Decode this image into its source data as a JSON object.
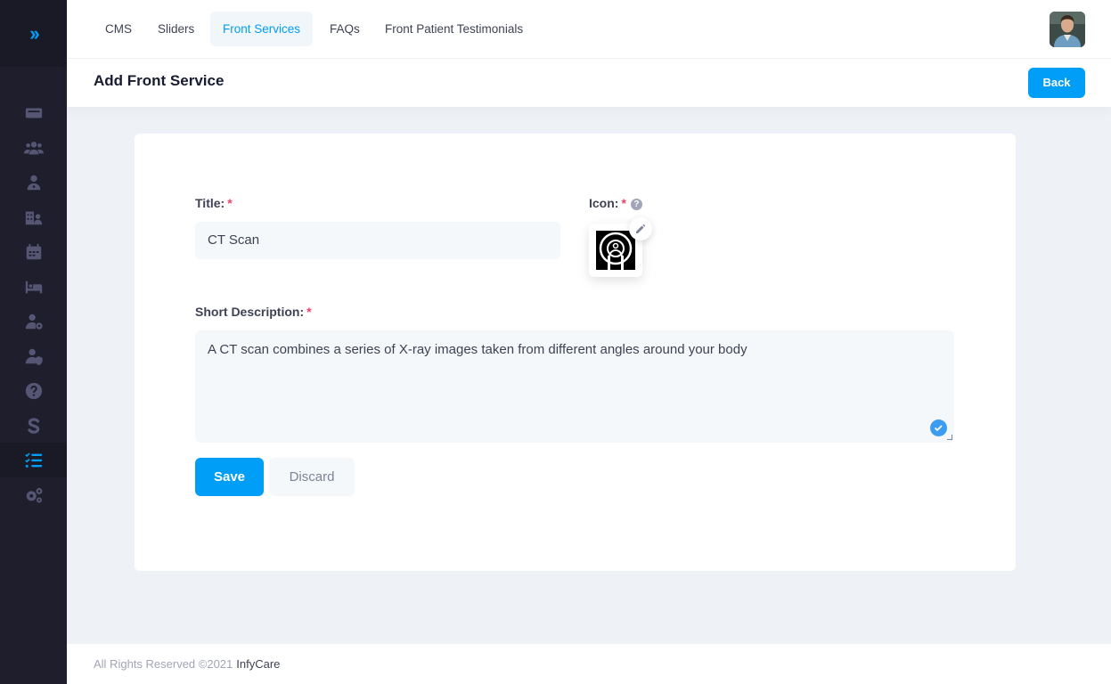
{
  "app": {
    "name": "InfyCare"
  },
  "colors": {
    "accent": "#009ef7",
    "sidebar": "#1e1e2d",
    "required": "#f1416c"
  },
  "sidebar": {
    "toggle_icon": "double-chevron-right-icon",
    "items": [
      {
        "icon": "dashboard-icon"
      },
      {
        "icon": "users-icon"
      },
      {
        "icon": "doctor-icon"
      },
      {
        "icon": "hospital-icon"
      },
      {
        "icon": "calendar-icon"
      },
      {
        "icon": "bed-icon"
      },
      {
        "icon": "user-settings-icon"
      },
      {
        "icon": "user-shield-icon"
      },
      {
        "icon": "question-icon"
      },
      {
        "icon": "subscription-s-icon"
      },
      {
        "icon": "cms-list-icon",
        "active": true
      },
      {
        "icon": "settings-gears-icon"
      }
    ]
  },
  "tabs": [
    {
      "label": "CMS"
    },
    {
      "label": "Sliders"
    },
    {
      "label": "Front Services",
      "active": true
    },
    {
      "label": "FAQs"
    },
    {
      "label": "Front Patient Testimonials"
    }
  ],
  "header": {
    "title": "Add Front Service",
    "back_label": "Back"
  },
  "form": {
    "title_label": "Title:",
    "title_value": "CT Scan",
    "icon_label": "Icon:",
    "required_mark": "*",
    "help_glyph": "?",
    "description_label": "Short Description:",
    "description_value": "A CT scan combines a series of X-ray images taken from different angles around your body",
    "save_label": "Save",
    "discard_label": "Discard"
  },
  "footer": {
    "text": "All Rights Reserved ©2021",
    "brand": "InfyCare"
  }
}
